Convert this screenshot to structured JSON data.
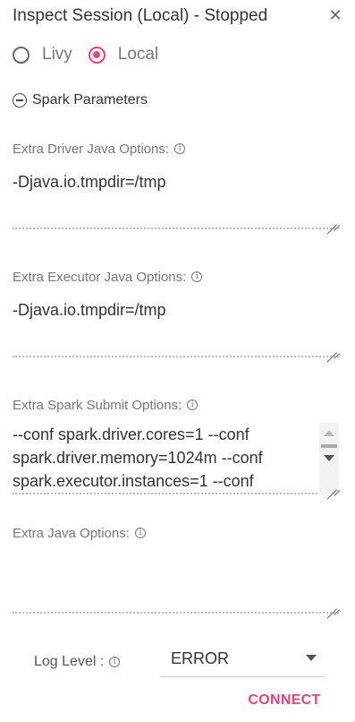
{
  "header": {
    "title": "Inspect Session (Local) - Stopped",
    "close_icon": "close-icon"
  },
  "mode": {
    "options": [
      {
        "label": "Livy",
        "selected": false
      },
      {
        "label": "Local",
        "selected": true
      }
    ]
  },
  "section": {
    "label": "Spark Parameters",
    "icon": "minus-circle-icon"
  },
  "fields": {
    "driver_java": {
      "label": "Extra Driver Java Options:",
      "value": "-Djava.io.tmpdir=/tmp"
    },
    "executor_java": {
      "label": "Extra Executor Java Options:",
      "value": "-Djava.io.tmpdir=/tmp"
    },
    "spark_submit": {
      "label": "Extra Spark Submit Options:",
      "value": "--conf spark.driver.cores=1 --conf spark.driver.memory=1024m --conf spark.executor.instances=1 --conf"
    },
    "java": {
      "label": "Extra Java Options:",
      "value": ""
    }
  },
  "log_level": {
    "label": "Log Level :",
    "value": "ERROR"
  },
  "actions": {
    "connect_label": "CONNECT"
  },
  "colors": {
    "accent": "#e8437a",
    "text": "#333333",
    "muted": "#777777"
  }
}
